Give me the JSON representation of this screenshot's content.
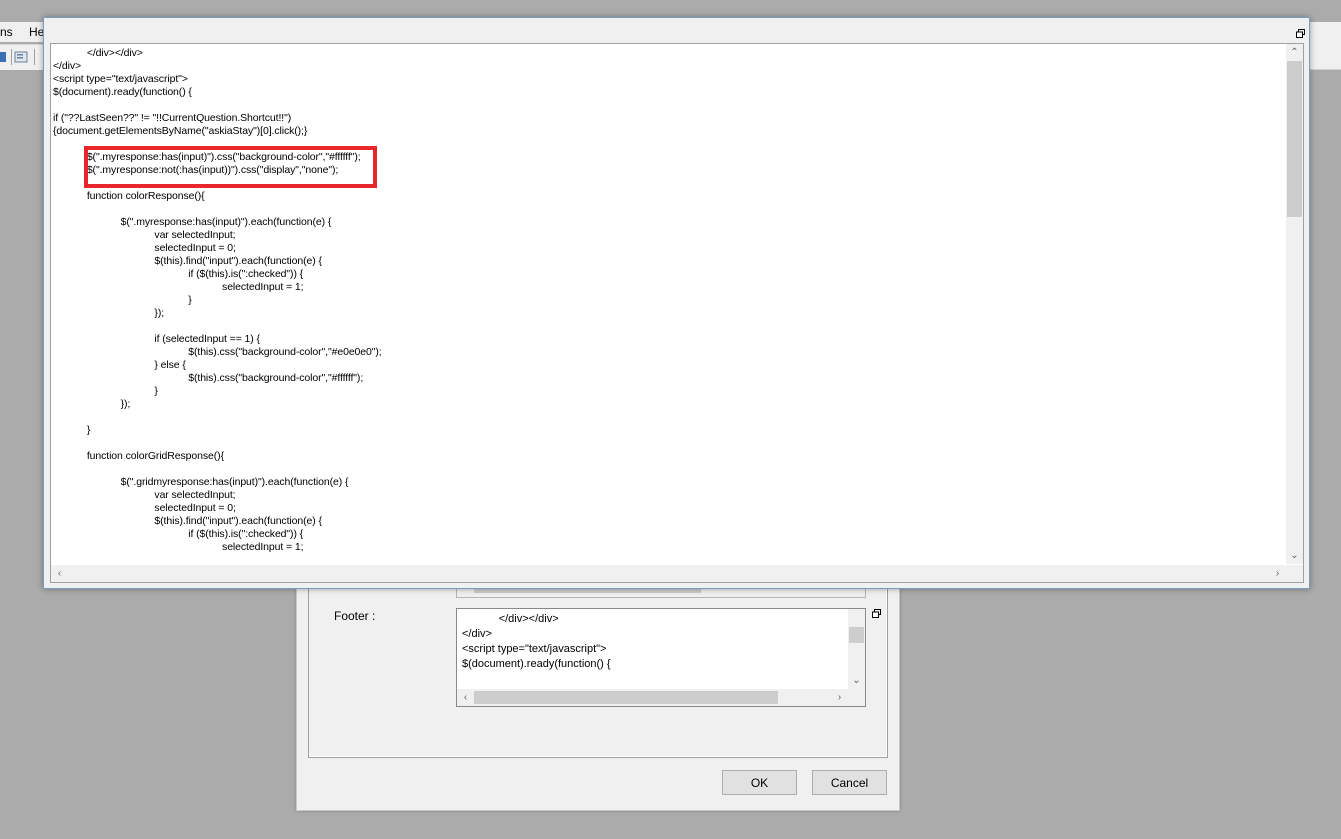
{
  "app": {
    "menu": [
      "ns",
      "He"
    ]
  },
  "editor": {
    "code_lines": [
      "\t\t</div></div>",
      "</div>",
      "<script type=\"text/javascript\">",
      "$(document).ready(function() {",
      "",
      "if (\"??LastSeen??\" != \"!!CurrentQuestion.Shortcut!!\")",
      "{document.getElementsByName(\"askiaStay\")[0].click();}",
      "",
      "\t\t$(\".myresponse:has(input)\").css(\"background-color\",\"#ffffff\");",
      "\t\t$(\".myresponse:not(:has(input))\").css(\"display\",\"none\");",
      "",
      "\t\tfunction colorResponse(){",
      "",
      "\t\t\t\t$(\".myresponse:has(input)\").each(function(e) {",
      "\t\t\t\t\t\tvar selectedInput;",
      "\t\t\t\t\t\tselectedInput = 0;",
      "\t\t\t\t\t\t$(this).find(\"input\").each(function(e) {",
      "\t\t\t\t\t\t\t\tif ($(this).is(\":checked\")) {",
      "\t\t\t\t\t\t\t\t\t\tselectedInput = 1;",
      "\t\t\t\t\t\t\t\t}",
      "\t\t\t\t\t\t});",
      "",
      "\t\t\t\t\t\tif (selectedInput == 1) {",
      "\t\t\t\t\t\t\t\t$(this).css(\"background-color\",\"#e0e0e0\");",
      "\t\t\t\t\t\t} else {",
      "\t\t\t\t\t\t\t\t$(this).css(\"background-color\",\"#ffffff\");",
      "\t\t\t\t\t\t}",
      "\t\t\t\t});",
      "",
      "\t\t}",
      "",
      "\t\tfunction colorGridResponse(){",
      "",
      "\t\t\t\t$(\".gridmyresponse:has(input)\").each(function(e) {",
      "\t\t\t\t\t\tvar selectedInput;",
      "\t\t\t\t\t\tselectedInput = 0;",
      "\t\t\t\t\t\t$(this).find(\"input\").each(function(e) {",
      "\t\t\t\t\t\t\t\tif ($(this).is(\":checked\")) {",
      "\t\t\t\t\t\t\t\t\t\tselectedInput = 1;"
    ]
  },
  "properties": {
    "footer_label": "Footer :",
    "footer_lines": [
      "\t\t</div></div>",
      "</div>",
      "<script type=\"text/javascript\">",
      "$(document).ready(function() {"
    ],
    "ok_label": "OK",
    "cancel_label": "Cancel"
  },
  "colors": {
    "highlight": "#e8262b",
    "background": "#ababab"
  },
  "icons": [
    "restore-icon",
    "scroll-up-icon",
    "scroll-down-icon",
    "scroll-left-icon",
    "scroll-right-icon"
  ]
}
